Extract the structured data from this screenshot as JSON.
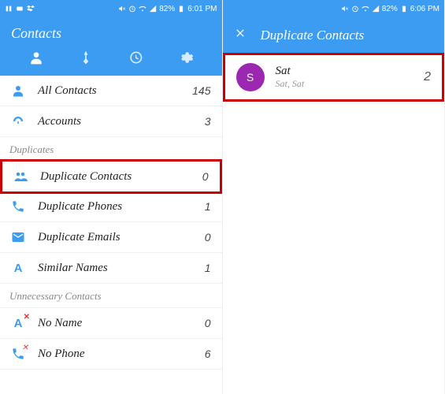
{
  "left": {
    "status": {
      "battery": "82%",
      "time": "6:01 PM"
    },
    "title": "Contacts",
    "sections": {
      "accounts": {
        "allContacts": {
          "label": "All Contacts",
          "count": "145"
        },
        "accounts": {
          "label": "Accounts",
          "count": "3"
        }
      },
      "duplicates": {
        "header": "Duplicates",
        "duplicateContacts": {
          "label": "Duplicate Contacts",
          "count": "0"
        },
        "duplicatePhones": {
          "label": "Duplicate Phones",
          "count": "1"
        },
        "duplicateEmails": {
          "label": "Duplicate Emails",
          "count": "0"
        },
        "similarNames": {
          "label": "Similar Names",
          "count": "1"
        }
      },
      "unnecessary": {
        "header": "Unnecessary Contacts",
        "noName": {
          "label": "No Name",
          "count": "0"
        },
        "noPhone": {
          "label": "No Phone",
          "count": "6"
        }
      }
    }
  },
  "right": {
    "status": {
      "battery": "82%",
      "time": "6:06 PM"
    },
    "title": "Duplicate Contacts",
    "item": {
      "initial": "S",
      "name": "Sat",
      "sub": "Sat, Sat",
      "count": "2"
    }
  }
}
